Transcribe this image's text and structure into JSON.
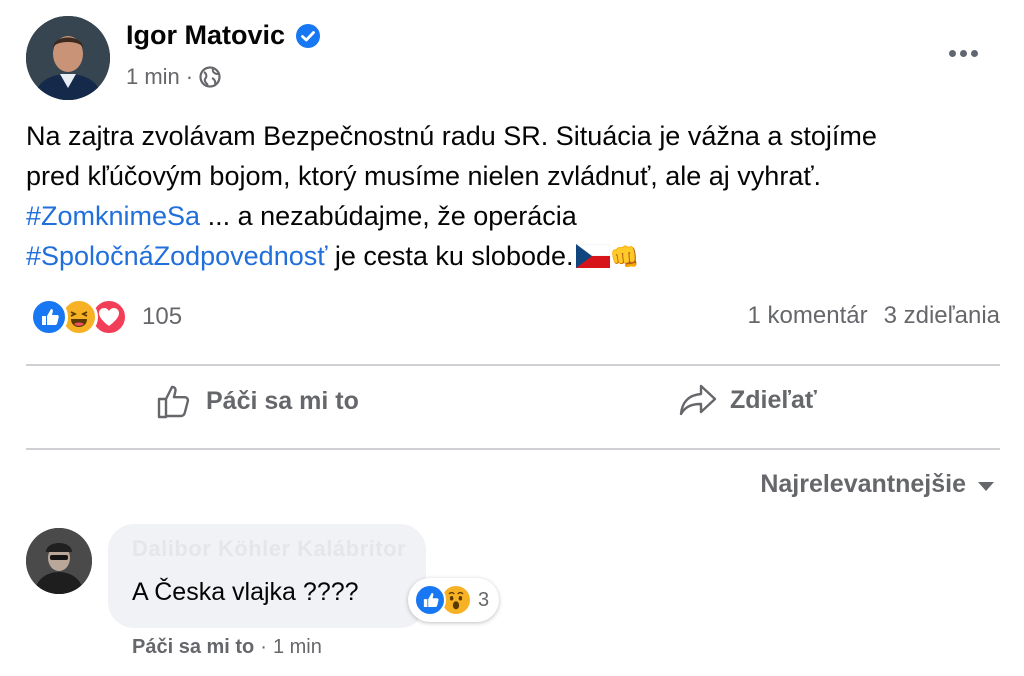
{
  "post": {
    "author": "Igor Matovic",
    "time": "1 min",
    "time_separator": "·",
    "text_lines": [
      "Na zajtra zvolávam Bezpečnostnú radu SR. Situácia je vážna a stojíme",
      "pred kľúčovým bojom, ktorý musíme nielen zvládnuť, ale aj vyhrať."
    ],
    "hashtag1": "#ZomknimeSa",
    "line3_rest": " ... a nezabúdajme, že operácia",
    "hashtag2": "#SpoločnáZodpovednosť",
    "line4_rest": " je cesta ku slobode.",
    "fist_emoji": "👊"
  },
  "reactions": {
    "icons": [
      "like-icon",
      "haha-icon",
      "love-icon"
    ],
    "count": "105",
    "comments": "1 komentár",
    "shares": "3 zdieľania"
  },
  "actions": {
    "like_label": "Páči sa mi to",
    "share_label": "Zdieľať"
  },
  "comments_sort": {
    "label": "Najrelevantnejšie"
  },
  "comment": {
    "author": "Dalibor Köhler Kalábritor",
    "text": "A Česka vlajka ????",
    "reaction_icons": [
      "like-icon",
      "wow-icon"
    ],
    "reaction_count": "3",
    "like_label": "Páči sa mi to",
    "separator": "·",
    "time": "1 min"
  },
  "colors": {
    "hashtag": "#216fdb",
    "secondary_text": "#65676b",
    "like_blue": "#1877f2",
    "love_red": "#f33e58",
    "haha_yellow": "#f7b125"
  }
}
